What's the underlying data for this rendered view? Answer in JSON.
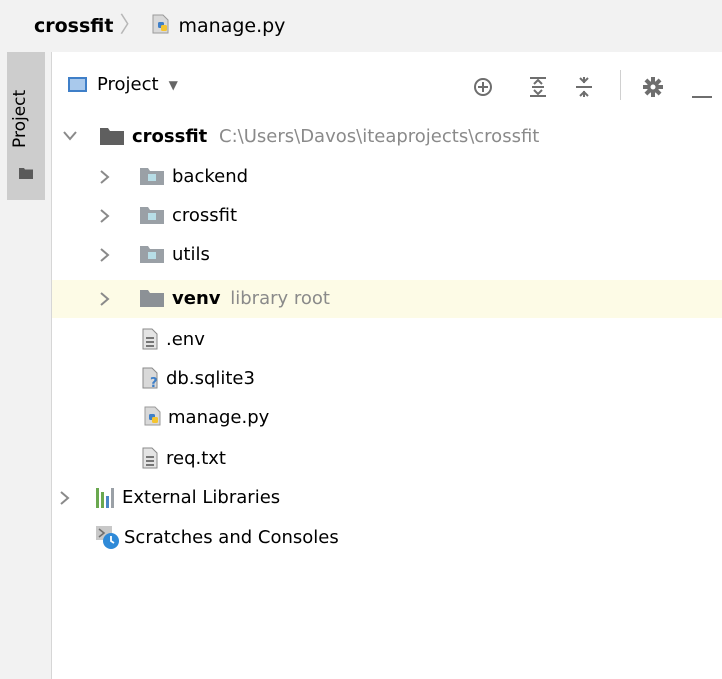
{
  "breadcrumb": {
    "project": "crossfit",
    "file": "manage.py"
  },
  "side_stripe": {
    "tab_label": "Project"
  },
  "tool_header": {
    "view_selector": "Project",
    "icons": [
      "locate-icon",
      "expand-all-icon",
      "collapse-all-icon",
      "gear-icon",
      "minimize-icon"
    ]
  },
  "tree": {
    "root": {
      "name": "crossfit",
      "path": "C:\\Users\\Davos\\iteaprojects\\crossfit"
    },
    "folders": [
      {
        "name": "backend"
      },
      {
        "name": "crossfit"
      },
      {
        "name": "utils"
      },
      {
        "name": "venv",
        "hint": "library root"
      }
    ],
    "files": [
      {
        "name": ".env",
        "icon": "text-file-icon"
      },
      {
        "name": "db.sqlite3",
        "icon": "unknown-file-icon"
      },
      {
        "name": "manage.py",
        "icon": "python-file-icon"
      },
      {
        "name": "req.txt",
        "icon": "text-file-icon"
      }
    ],
    "external_libraries": "External Libraries",
    "scratches": "Scratches and Consoles"
  },
  "colors": {
    "highlight_row": "#fdfbe6",
    "folder_gray": "#9aa0a6",
    "source_folder_teal": "#b7dde6"
  }
}
